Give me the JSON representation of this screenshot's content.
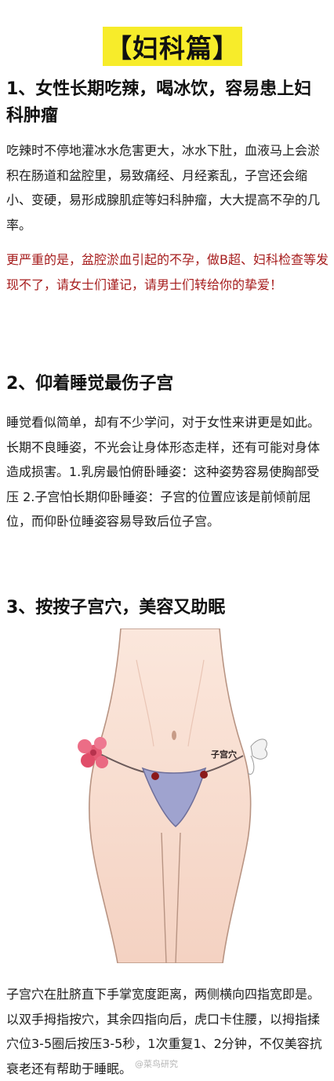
{
  "banner": {
    "title": "【妇科篇】"
  },
  "sections": [
    {
      "heading_line1": "1、女性长期吃辣，喝冰饮，容易患上妇",
      "heading_line2": "科肿瘤",
      "body": "吃辣时不停地灌冰水危害更大，冰水下肚，血液马上会淤积在肠道和盆腔里，易致痛经、月经紊乱，子宫还会缩小、变硬，易形成腺肌症等妇科肿瘤，大大提高不孕的几率。",
      "warning": "更严重的是，盆腔淤血引起的不孕，做B超、妇科检查等发现不了，请女士们谨记，请男士们转给你的挚爱！"
    },
    {
      "heading": "2、仰着睡觉最伤子宫",
      "body": "睡觉看似简单，却有不少学问，对于女性来讲更是如此。长期不良睡姿，不光会让身体形态走样，还有可能对身体造成损害。1.乳房最怕俯卧睡姿：这种姿势容易使胸部受压 2.子宫怕长期仰卧睡姿：子宫的位置应该是前倾前屈位，而仰卧位睡姿容易导致后位子宫。"
    },
    {
      "heading": "3、按按子宫穴，美容又助眠",
      "figure_label": "子宫穴",
      "body": "子宫穴在肚脐直下手掌宽度距离，两侧横向四指宽即是。以双手拇指按穴，其余四指向后，虎口卡住腰，以拇指揉穴位3-5圈后按压3-5秒，1次重复1、2分钟，不仅美容抗衰老还有帮助于睡眠。"
    }
  ],
  "watermark": "@菜鸟研究"
}
